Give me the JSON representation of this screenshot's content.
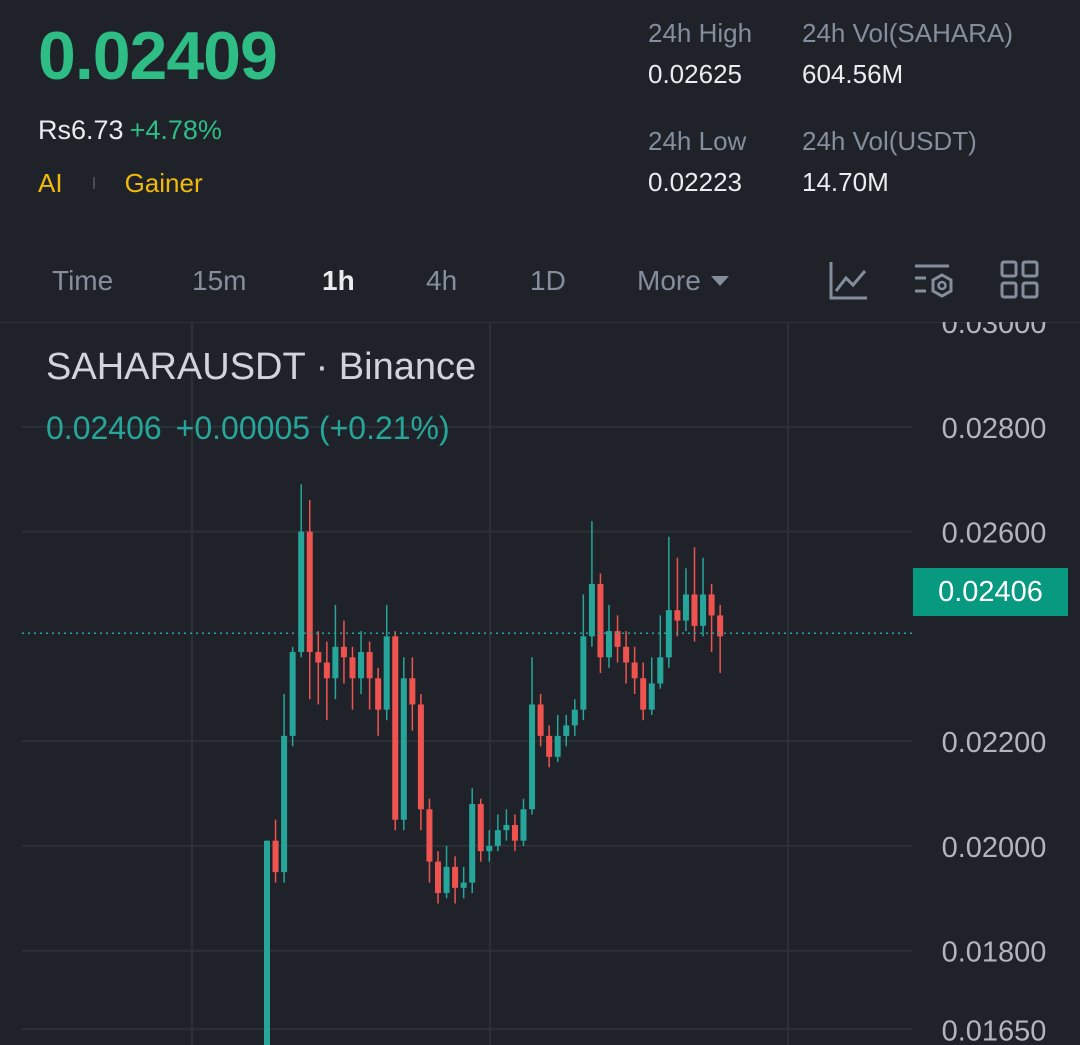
{
  "header": {
    "last_price": "0.02409",
    "fiat_price": "Rs6.73",
    "change_pct": "+4.78%",
    "tags": [
      "AI",
      "Gainer"
    ],
    "stats": {
      "high_label": "24h High",
      "high_value": "0.02625",
      "vol_base_label": "24h Vol(SAHARA)",
      "vol_base_value": "604.56M",
      "low_label": "24h Low",
      "low_value": "0.02223",
      "vol_quote_label": "24h Vol(USDT)",
      "vol_quote_value": "14.70M"
    },
    "colors": {
      "up": "#2ebd85",
      "down": "#f6465d",
      "tag": "#f0b90b"
    }
  },
  "intervals": {
    "items": [
      "Time",
      "15m",
      "1h",
      "4h",
      "1D"
    ],
    "active": "1h",
    "more_label": "More",
    "tool_icons": [
      "indicator-chart-icon",
      "chart-settings-icon",
      "grid-layout-icon"
    ]
  },
  "chart_legend": {
    "symbol": "SAHARAUSDT · Binance",
    "value": "0.02406",
    "change": "+0.00005 (+0.21%)"
  },
  "chart_data": {
    "type": "candlestick",
    "title": "SAHARAUSDT · Binance",
    "y_ticks": [
      "0.03000",
      "0.02800",
      "0.02600",
      "0.02200",
      "0.02000",
      "0.01800",
      "0.01650"
    ],
    "last_price_label": "0.02406",
    "last_price": 0.02406,
    "ylim": [
      0.0162,
      0.03
    ],
    "up_color": "#26a69a",
    "down_color": "#ef5350",
    "candles": [
      [
        0.0155,
        0.0201,
        0.0155,
        0.0201
      ],
      [
        0.0201,
        0.0195,
        0.0205,
        0.0193
      ],
      [
        0.0195,
        0.0221,
        0.0229,
        0.0193
      ],
      [
        0.0221,
        0.0237,
        0.0238,
        0.0219
      ],
      [
        0.0237,
        0.026,
        0.0269,
        0.0236
      ],
      [
        0.026,
        0.0237,
        0.0266,
        0.0228
      ],
      [
        0.0237,
        0.0235,
        0.0241,
        0.0227
      ],
      [
        0.0235,
        0.0232,
        0.0239,
        0.0224
      ],
      [
        0.0232,
        0.0238,
        0.0246,
        0.0228
      ],
      [
        0.0238,
        0.0236,
        0.0243,
        0.0231
      ],
      [
        0.0236,
        0.0232,
        0.0238,
        0.0226
      ],
      [
        0.0232,
        0.0237,
        0.0241,
        0.0229
      ],
      [
        0.0237,
        0.0232,
        0.0239,
        0.0226
      ],
      [
        0.0232,
        0.0226,
        0.0234,
        0.0221
      ],
      [
        0.0226,
        0.024,
        0.0246,
        0.0224
      ],
      [
        0.024,
        0.0205,
        0.0241,
        0.0203
      ],
      [
        0.0205,
        0.0232,
        0.0236,
        0.0203
      ],
      [
        0.0232,
        0.0227,
        0.0236,
        0.0222
      ],
      [
        0.0227,
        0.0207,
        0.0229,
        0.0203
      ],
      [
        0.0207,
        0.0197,
        0.0209,
        0.0193
      ],
      [
        0.0197,
        0.0191,
        0.0199,
        0.0189
      ],
      [
        0.0191,
        0.0196,
        0.02,
        0.019
      ],
      [
        0.0196,
        0.0192,
        0.0198,
        0.0189
      ],
      [
        0.0192,
        0.0193,
        0.0196,
        0.019
      ],
      [
        0.0193,
        0.0208,
        0.0211,
        0.0191
      ],
      [
        0.0208,
        0.0199,
        0.0209,
        0.0197
      ],
      [
        0.0199,
        0.02,
        0.0203,
        0.0197
      ],
      [
        0.02,
        0.0203,
        0.0206,
        0.0199
      ],
      [
        0.0203,
        0.0204,
        0.0207,
        0.0201
      ],
      [
        0.0204,
        0.0201,
        0.0206,
        0.0199
      ],
      [
        0.0201,
        0.0207,
        0.0209,
        0.02
      ],
      [
        0.0207,
        0.0227,
        0.0236,
        0.0206
      ],
      [
        0.0227,
        0.0221,
        0.0229,
        0.0219
      ],
      [
        0.0221,
        0.0217,
        0.0223,
        0.0215
      ],
      [
        0.0217,
        0.0221,
        0.0225,
        0.0216
      ],
      [
        0.0221,
        0.0223,
        0.0225,
        0.0219
      ],
      [
        0.0223,
        0.0226,
        0.0228,
        0.0221
      ],
      [
        0.0226,
        0.024,
        0.0248,
        0.0224
      ],
      [
        0.024,
        0.025,
        0.0262,
        0.0238
      ],
      [
        0.025,
        0.0236,
        0.0252,
        0.0233
      ],
      [
        0.0236,
        0.0241,
        0.0246,
        0.0234
      ],
      [
        0.0241,
        0.0238,
        0.0244,
        0.0235
      ],
      [
        0.0238,
        0.0235,
        0.0241,
        0.0231
      ],
      [
        0.0235,
        0.0232,
        0.0238,
        0.0229
      ],
      [
        0.0232,
        0.0226,
        0.0235,
        0.0224
      ],
      [
        0.0226,
        0.0231,
        0.0236,
        0.0225
      ],
      [
        0.0231,
        0.0236,
        0.0244,
        0.023
      ],
      [
        0.0236,
        0.0245,
        0.0259,
        0.0234
      ],
      [
        0.0245,
        0.0243,
        0.0255,
        0.024
      ],
      [
        0.0243,
        0.0248,
        0.0253,
        0.0241
      ],
      [
        0.0248,
        0.0242,
        0.0257,
        0.0239
      ],
      [
        0.0242,
        0.0248,
        0.0255,
        0.024
      ],
      [
        0.0248,
        0.0244,
        0.025,
        0.0237
      ],
      [
        0.0244,
        0.024,
        0.0246,
        0.0233
      ]
    ]
  }
}
